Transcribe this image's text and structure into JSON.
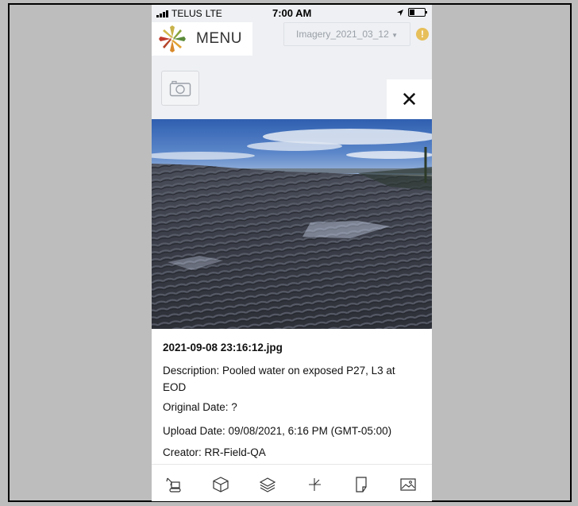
{
  "status_bar": {
    "carrier": "TELUS",
    "network": "LTE",
    "time": "7:00 AM"
  },
  "header": {
    "menu_label": "MENU",
    "imagery_select": "Imagery_2021_03_12",
    "alert_symbol": "!"
  },
  "close_symbol": "✕",
  "photo": {
    "filename": "2021-09-08 23:16:12.jpg",
    "description": "Description: Pooled water on exposed P27, L3 at EOD",
    "original_date": "Original Date: ?",
    "upload_date": "Upload Date: 09/08/2021, 6:16 PM (GMT-05:00)",
    "creator": "Creator: RR-Field-QA"
  },
  "toolbar": {
    "icons": [
      "excavator-icon",
      "cube-icon",
      "layers-icon",
      "measure-icon",
      "document-icon",
      "image-icon"
    ]
  },
  "colors": {
    "accent_alert": "#e7bf5a",
    "page_background": "#bdbdbd"
  }
}
